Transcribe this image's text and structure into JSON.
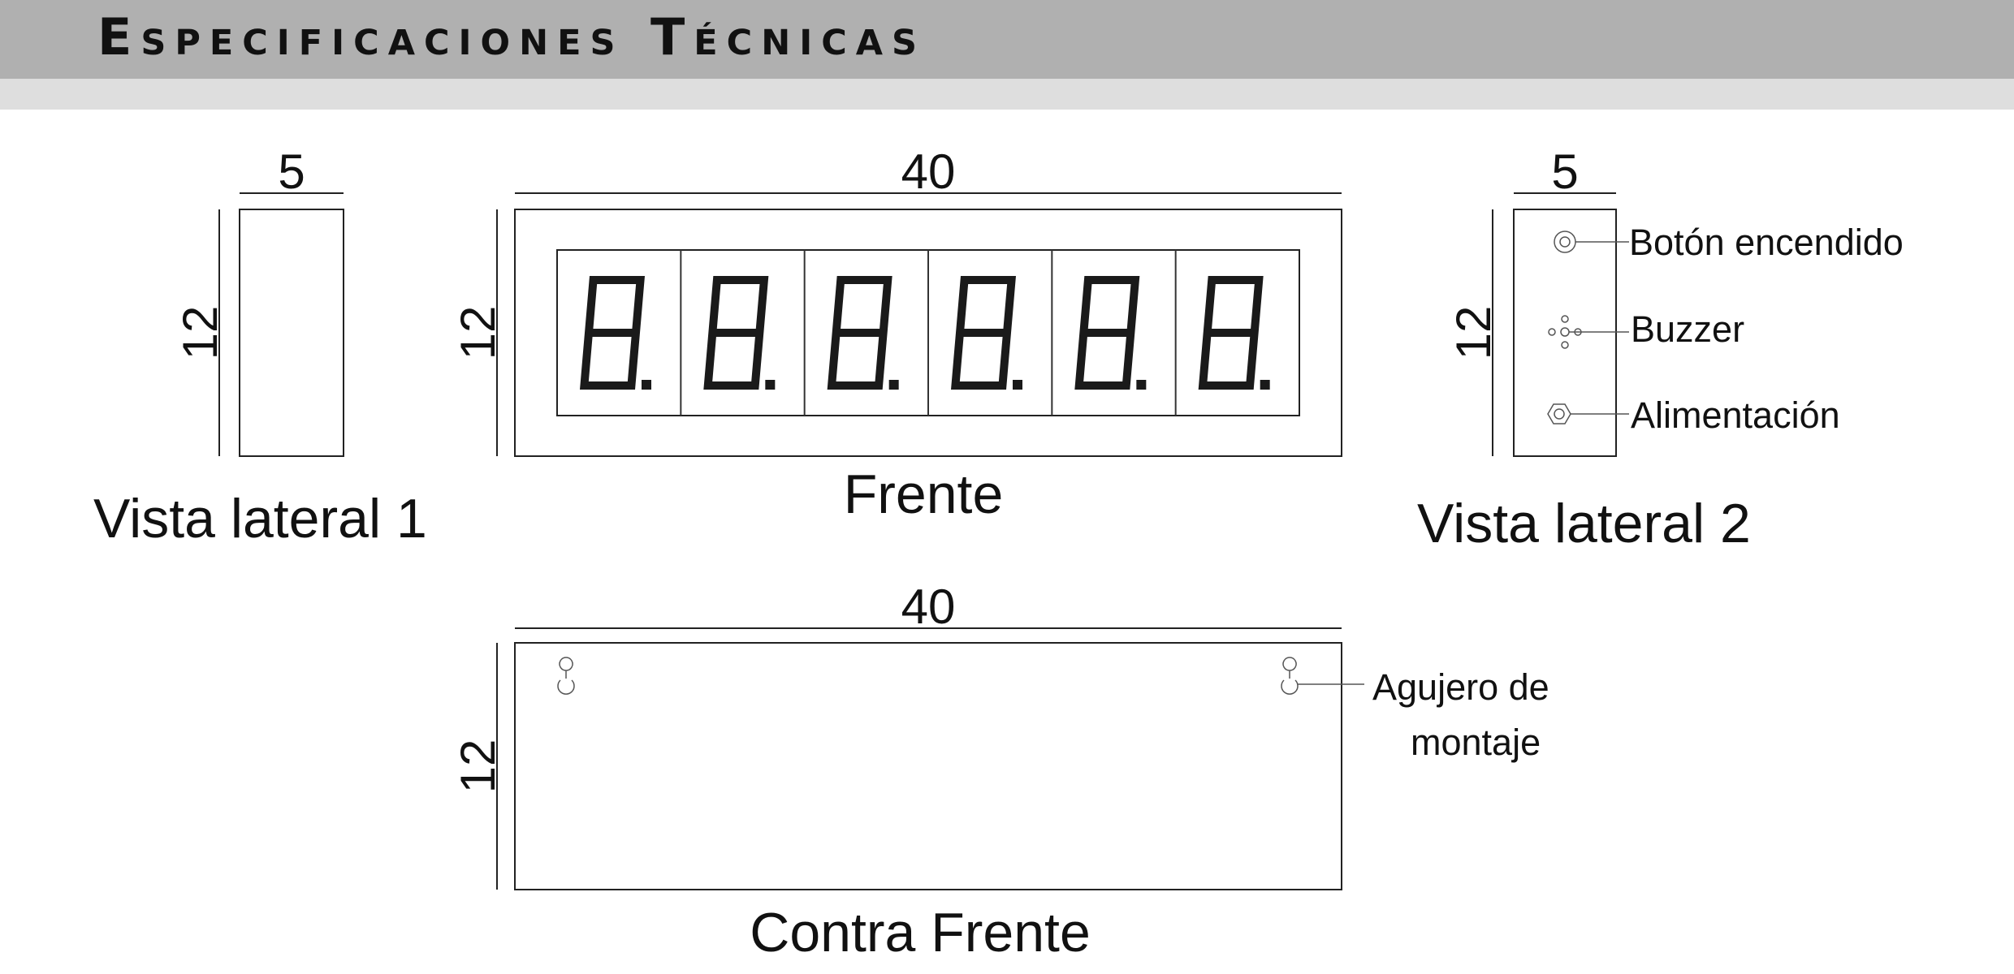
{
  "header": {
    "title": "Especificaciones Técnicas"
  },
  "dimensions": {
    "side_width": "5",
    "front_width": "40",
    "height": "12",
    "side2_width": "5",
    "back_width": "40"
  },
  "views": {
    "side1": "Vista lateral 1",
    "front": "Frente",
    "side2": "Vista lateral 2",
    "back": "Contra Frente"
  },
  "callouts": {
    "power_button": "Botón encendido",
    "buzzer": "Buzzer",
    "power_supply": "Alimentación",
    "mount_hole_line1": "Agujero de",
    "mount_hole_line2": "montaje"
  },
  "display": {
    "digit_count": 6
  }
}
